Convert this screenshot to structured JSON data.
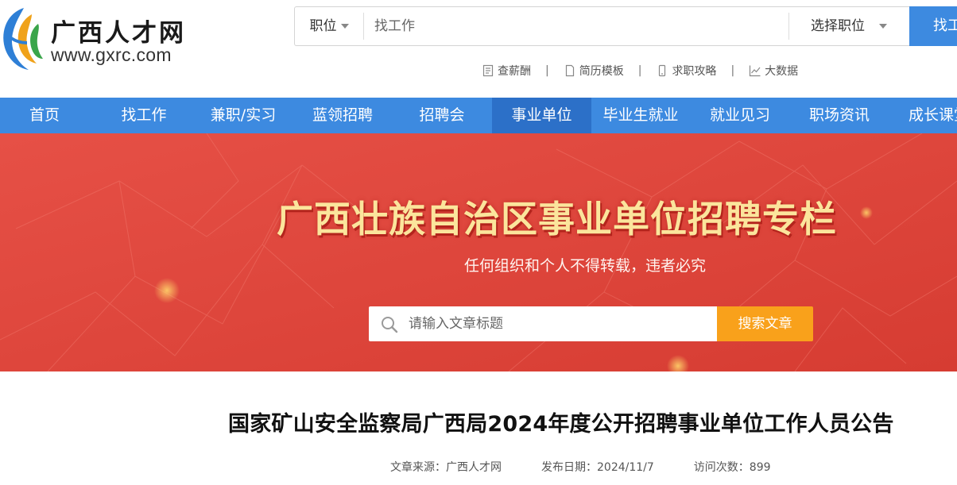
{
  "logo": {
    "name": "广西人才网",
    "url": "www.gxrc.com"
  },
  "search": {
    "type_label": "职位",
    "placeholder": "找工作",
    "position_label": "选择职位",
    "button_label": "找工作"
  },
  "quick_links": [
    {
      "label": "查薪酬",
      "icon": "file-list-icon"
    },
    {
      "label": "简历模板",
      "icon": "document-icon"
    },
    {
      "label": "求职攻略",
      "icon": "phone-icon"
    },
    {
      "label": "大数据",
      "icon": "line-chart-icon"
    }
  ],
  "quick_link_separator": "|",
  "nav": {
    "items": [
      "首页",
      "找工作",
      "兼职/实习",
      "蓝领招聘",
      "招聘会",
      "事业单位",
      "毕业生就业",
      "就业见习",
      "职场资讯",
      "成长课堂"
    ],
    "active_index": 5
  },
  "banner": {
    "title": "广西壮族自治区事业单位招聘专栏",
    "subtitle": "任何组织和个人不得转载，违者必究",
    "search_placeholder": "请输入文章标题",
    "search_button": "搜索文章"
  },
  "article": {
    "title": "国家矿山安全监察局广西局2024年度公开招聘事业单位工作人员公告",
    "source": "文章来源：广西人才网",
    "date": "发布日期：2024/11/7",
    "views": "访问次数：899"
  },
  "colors": {
    "nav_bg": "#3d8ae0",
    "nav_active": "#2c70c8",
    "banner_bg": "#e0463b",
    "banner_title": "#fbe59c",
    "search_button": "#f9a11b"
  }
}
